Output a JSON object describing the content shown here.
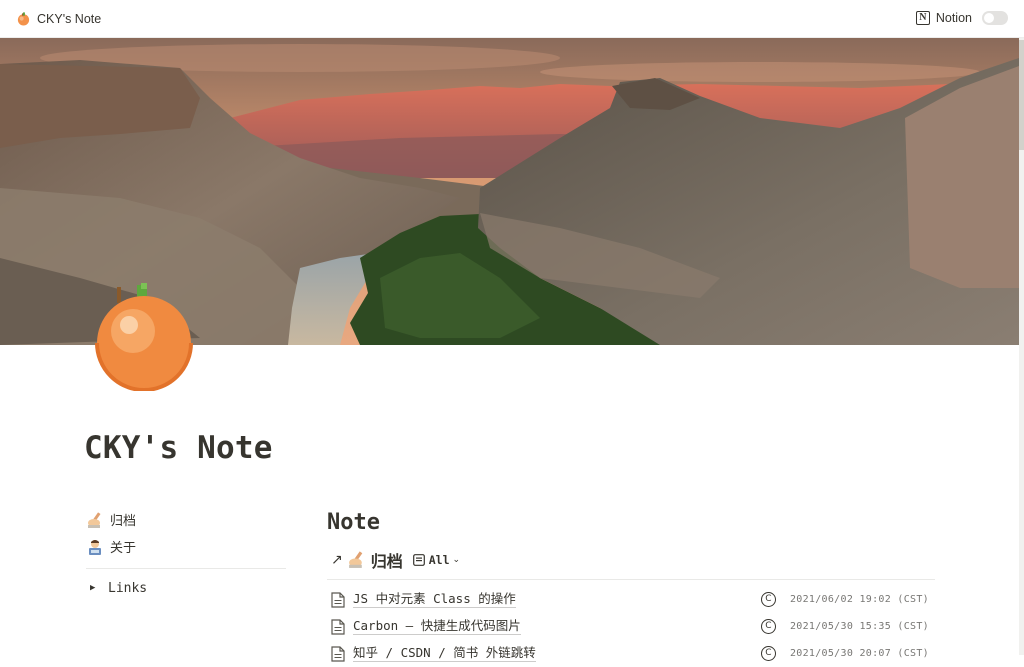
{
  "topbar": {
    "site_title": "CKY's Note",
    "notion_label": "Notion",
    "toggle_on": false
  },
  "page": {
    "title": "CKY's Note",
    "icon": "peach-emoji"
  },
  "nav": {
    "items": [
      {
        "icon": "writing-hand-emoji",
        "label": "归档"
      },
      {
        "icon": "person-at-computer-emoji",
        "label": "关于"
      }
    ],
    "toggle": {
      "label": "Links",
      "expanded": false
    }
  },
  "main": {
    "heading": "Note",
    "view": {
      "linked_name": "归档",
      "selector_label": "All"
    },
    "rows": [
      {
        "title": "JS 中对元素 Class 的操作",
        "date": "2021/06/02 19:02 (CST)"
      },
      {
        "title": "Carbon — 快捷生成代码图片",
        "date": "2021/05/30 15:35 (CST)"
      },
      {
        "title": "知乎 / CSDN / 简书 外链跳转",
        "date": "2021/05/30 20:07 (CST)"
      }
    ]
  },
  "colors": {
    "text": "#37352f",
    "muted": "#787774",
    "divider": "#e9e9e7",
    "peach": "#f08a40"
  }
}
